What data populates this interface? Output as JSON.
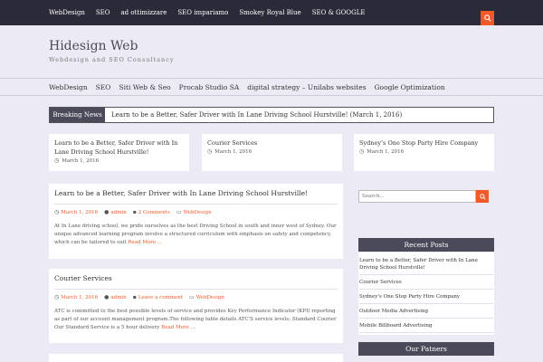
{
  "top_nav": [
    "WebDesign",
    "SEO",
    "ad ottimizzare",
    "SEO impariamo",
    "Smokey Royal Blue",
    "SEO & GOOGLE"
  ],
  "site": {
    "title": "Hidesign Web",
    "tagline": "Webdesign and SEO Consultancy"
  },
  "main_nav": [
    "WebDesign",
    "SEO",
    "Siti Web & Seo",
    "Procab Studio SA",
    "digital strategy – Unilabs websites",
    "Google Optimization"
  ],
  "ticker": {
    "label": "Breaking News",
    "text": "Learn to be a Better, Safer Driver with In Lane Driving School Hurstville! (March 1, 2016)"
  },
  "featured": [
    {
      "title": "Learn to be a Better, Safer Driver with In Lane Driving School Hurstville!",
      "date": "March 1, 2016"
    },
    {
      "title": "Courier Services",
      "date": "March 1, 2016"
    },
    {
      "title": "Sydney’s One Stop Party Hire Company",
      "date": "March 1, 2016"
    }
  ],
  "posts": [
    {
      "title": "Learn to be a Better, Safer Driver with In Lane Driving School Hurstville!",
      "date": "March 1, 2016",
      "author": "admin",
      "comments": "2 Comments",
      "category": "WebDesign",
      "excerpt": "At In Lane driving school, we pride ourselves as the best Driving School in south and inner west of Sydney. Our unique advanced learning program involve a structured curriculum with emphasis on safety and competency, which can be tailored to suit",
      "more": "Read More …"
    },
    {
      "title": "Courier Services",
      "date": "March 1, 2016",
      "author": "admin",
      "comments": "Leave a comment",
      "category": "WebDesign",
      "excerpt": "ATC is committed to the best possible levels of service and provides Key Performance Indicator (KPI) reporting as part of our account management program.The following table details ATC'S service levels: Standard Courier Our Standard Service is a 5 hour delivery",
      "more": "Read More …"
    }
  ],
  "sidebar": {
    "search_placeholder": "Search...",
    "recent_title": "Recent Posts",
    "recent": [
      "Learn to be a Better, Safer Driver with In Lane Driving School Hurstville!",
      "Courier Services",
      "Sydney’s One Stop Party Hire Company",
      "Outdoor Media Advertising",
      "Mobile Billboard Advertising"
    ],
    "partners_title": "Our Patners"
  },
  "colors": {
    "accent": "#f05a28",
    "dark": "#2b2a38",
    "header": "#4a4a5a",
    "background": "#ecebf5"
  }
}
